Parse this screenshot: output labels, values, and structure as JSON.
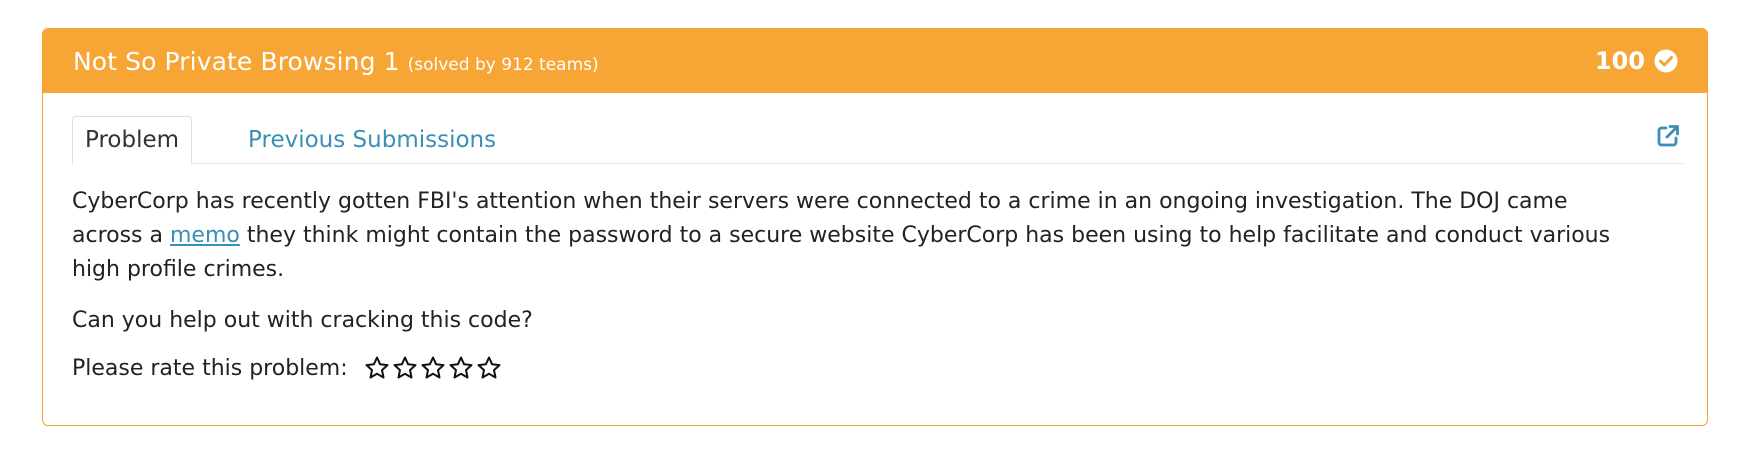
{
  "problem": {
    "title": "Not So Private Browsing 1",
    "solved": "(solved by 912 teams)",
    "points": "100"
  },
  "tabs": [
    {
      "label": "Problem",
      "active": true
    },
    {
      "label": "Previous Submissions",
      "active": false
    }
  ],
  "description": {
    "part1": "CyberCorp has recently gotten FBI's attention when their servers were connected to a crime in an ongoing investigation. The DOJ came across a ",
    "link": "memo",
    "part2": " they think might contain the password to a secure website CyberCorp has been using to help facilitate and conduct various high profile crimes."
  },
  "question": "Can you help out with cracking this code?",
  "rating": {
    "label": "Please rate this problem:",
    "max_stars": 5,
    "current": 0
  },
  "colors": {
    "header_bg": "#f7a535",
    "border": "#f6a233",
    "link": "#3a8fb7"
  }
}
